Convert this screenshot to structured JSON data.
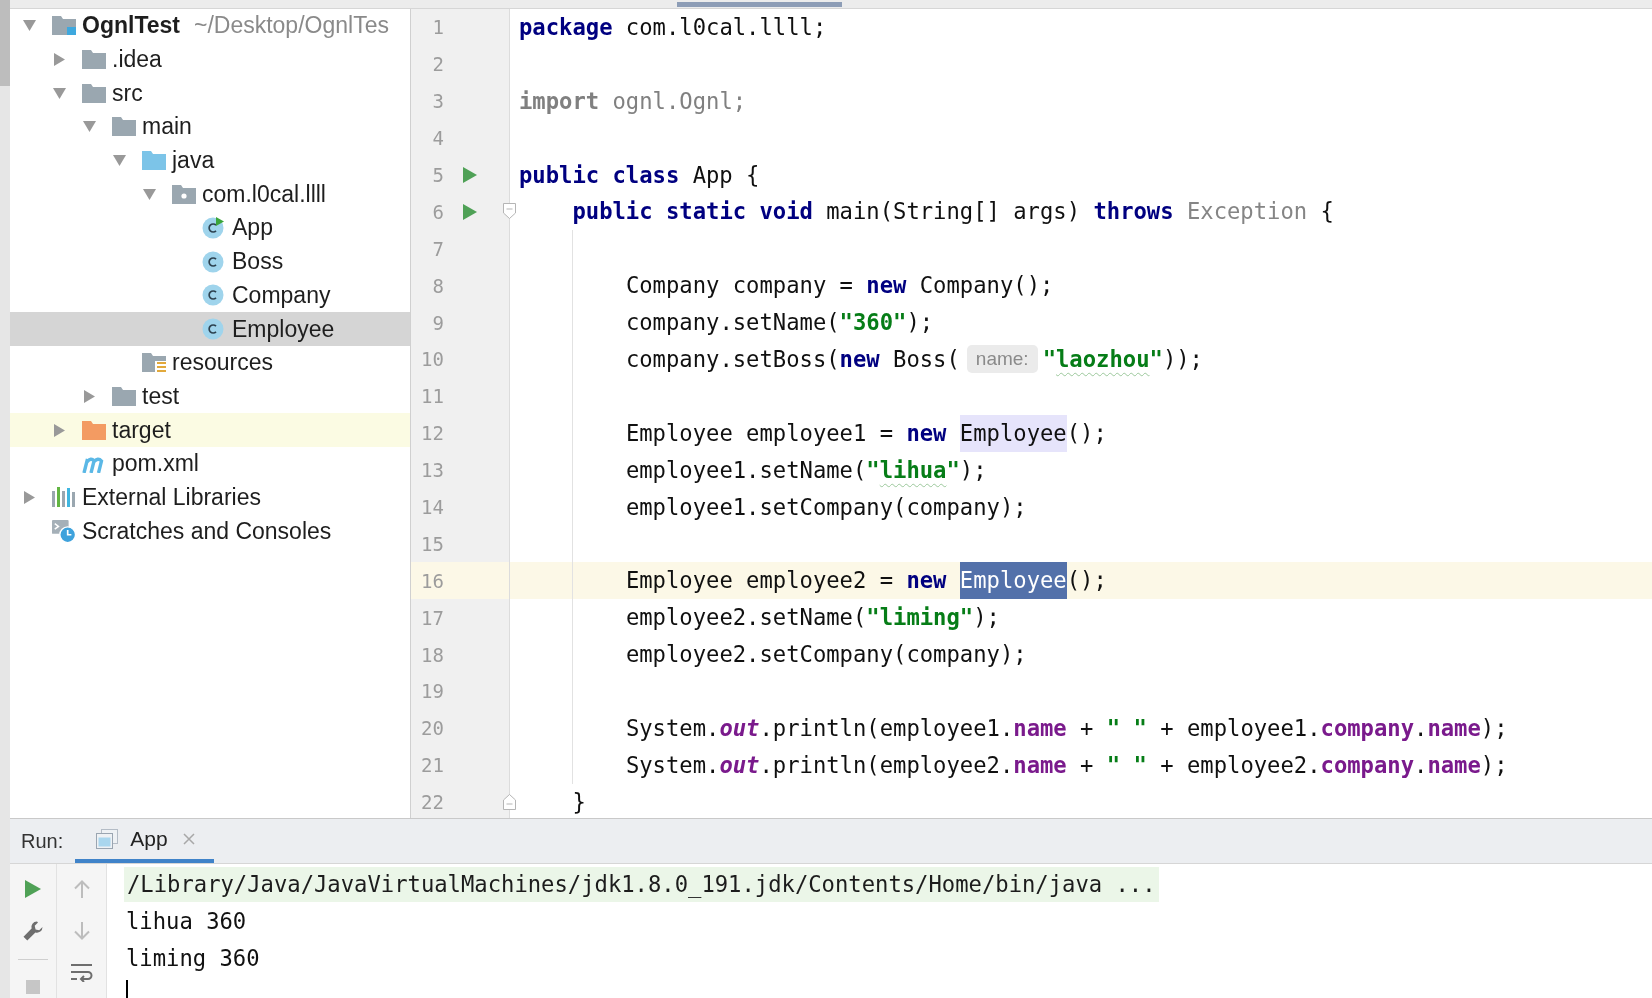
{
  "project_tree": [
    {
      "label": "OgnlTest",
      "detail": "~/Desktop/OgnlTes",
      "kind": "module",
      "expanded": true,
      "selected": false,
      "ignored": false,
      "children": [
        {
          "label": ".idea",
          "kind": "folder",
          "expanded": false,
          "selected": false,
          "ignored": false
        },
        {
          "label": "src",
          "kind": "folder",
          "expanded": true,
          "selected": false,
          "ignored": false,
          "children": [
            {
              "label": "main",
              "kind": "folder",
              "expanded": true,
              "selected": false,
              "ignored": false,
              "children": [
                {
                  "label": "java",
                  "kind": "source-root",
                  "expanded": true,
                  "selected": false,
                  "ignored": false,
                  "children": [
                    {
                      "label": "com.l0cal.llll",
                      "kind": "package",
                      "expanded": true,
                      "selected": false,
                      "ignored": false,
                      "children": [
                        {
                          "label": "App",
                          "kind": "main-class",
                          "selected": false,
                          "ignored": false
                        },
                        {
                          "label": "Boss",
                          "kind": "class",
                          "selected": false,
                          "ignored": false
                        },
                        {
                          "label": "Company",
                          "kind": "class",
                          "selected": false,
                          "ignored": false
                        },
                        {
                          "label": "Employee",
                          "kind": "class",
                          "selected": true,
                          "ignored": false
                        }
                      ]
                    }
                  ]
                },
                {
                  "label": "resources",
                  "kind": "resources-root",
                  "selected": false,
                  "ignored": false
                }
              ]
            },
            {
              "label": "test",
              "kind": "folder",
              "expanded": false,
              "selected": false,
              "ignored": false
            }
          ]
        },
        {
          "label": "target",
          "kind": "excluded-folder",
          "expanded": false,
          "selected": false,
          "ignored": true
        },
        {
          "label": "pom.xml",
          "kind": "maven",
          "selected": false,
          "ignored": false
        }
      ]
    },
    {
      "label": "External Libraries",
      "kind": "libraries",
      "expanded": false,
      "selected": false,
      "ignored": false
    },
    {
      "label": "Scratches and Consoles",
      "kind": "scratches",
      "selected": false,
      "ignored": false
    }
  ],
  "editor": {
    "lines": [
      {
        "number": "1",
        "run_marker": false,
        "fold_marker": false,
        "current": false,
        "tokens": [
          {
            "text": "package",
            "kind": "keyword"
          },
          {
            "text": " com.l0cal.llll;",
            "kind": "plain"
          }
        ]
      },
      {
        "number": "2",
        "run_marker": false,
        "fold_marker": false,
        "current": false
      },
      {
        "number": "3",
        "run_marker": false,
        "fold_marker": false,
        "current": false,
        "tokens": [
          {
            "text": "import",
            "kind": "unused-keyword"
          },
          {
            "text": " ognl.Ognl;",
            "kind": "unused"
          }
        ]
      },
      {
        "number": "4",
        "run_marker": false,
        "fold_marker": false,
        "current": false
      },
      {
        "number": "5",
        "run_marker": true,
        "fold_marker": false,
        "current": false,
        "tokens": [
          {
            "text": "public class",
            "kind": "keyword"
          },
          {
            "text": " App {",
            "kind": "plain"
          }
        ]
      },
      {
        "number": "6",
        "run_marker": true,
        "fold_marker": true,
        "current": false,
        "tokens": [
          {
            "text": "    public static void",
            "kind": "keyword"
          },
          {
            "text": " main(String[] args) ",
            "kind": "plain"
          },
          {
            "text": "throws",
            "kind": "keyword"
          },
          {
            "text": " Exception",
            "kind": "dimmed"
          },
          {
            "text": " {",
            "kind": "plain"
          }
        ]
      },
      {
        "number": "7",
        "run_marker": false,
        "fold_marker": false,
        "current": false
      },
      {
        "number": "8",
        "run_marker": false,
        "fold_marker": false,
        "current": false,
        "tokens": [
          {
            "text": "        Company company = ",
            "kind": "plain"
          },
          {
            "text": "new",
            "kind": "keyword"
          },
          {
            "text": " Company();",
            "kind": "plain"
          }
        ]
      },
      {
        "number": "9",
        "run_marker": false,
        "fold_marker": false,
        "current": false,
        "tokens": [
          {
            "text": "        company.setName(",
            "kind": "plain"
          },
          {
            "text": "\"360\"",
            "kind": "string"
          },
          {
            "text": ");",
            "kind": "plain"
          }
        ]
      },
      {
        "number": "10",
        "run_marker": false,
        "fold_marker": false,
        "current": false,
        "tokens": [
          {
            "text": "        company.setBoss(",
            "kind": "plain"
          },
          {
            "text": "new",
            "kind": "keyword"
          },
          {
            "text": " Boss(",
            "kind": "plain"
          },
          {
            "text": "name:",
            "kind": "hint"
          },
          {
            "text": "\"",
            "kind": "string"
          },
          {
            "text": "laozhou",
            "kind": "string-typo"
          },
          {
            "text": "\"",
            "kind": "string"
          },
          {
            "text": "));",
            "kind": "plain"
          }
        ]
      },
      {
        "number": "11",
        "run_marker": false,
        "fold_marker": false,
        "current": false
      },
      {
        "number": "12",
        "run_marker": false,
        "fold_marker": false,
        "current": false,
        "tokens": [
          {
            "text": "        Employee employee1 = ",
            "kind": "plain"
          },
          {
            "text": "new ",
            "kind": "keyword"
          },
          {
            "text": "Employee",
            "kind": "usage"
          },
          {
            "text": "();",
            "kind": "plain"
          }
        ]
      },
      {
        "number": "13",
        "run_marker": false,
        "fold_marker": false,
        "current": false,
        "tokens": [
          {
            "text": "        employee1.setName(",
            "kind": "plain"
          },
          {
            "text": "\"",
            "kind": "string"
          },
          {
            "text": "lihua",
            "kind": "string-typo"
          },
          {
            "text": "\"",
            "kind": "string"
          },
          {
            "text": ");",
            "kind": "plain"
          }
        ]
      },
      {
        "number": "14",
        "run_marker": false,
        "fold_marker": false,
        "current": false,
        "tokens": [
          {
            "text": "        employee1.setCompany(company);",
            "kind": "plain"
          }
        ]
      },
      {
        "number": "15",
        "run_marker": false,
        "fold_marker": false,
        "current": false
      },
      {
        "number": "16",
        "run_marker": false,
        "fold_marker": false,
        "current": true,
        "tokens": [
          {
            "text": "        Employee employee2 = ",
            "kind": "plain"
          },
          {
            "text": "new ",
            "kind": "keyword"
          },
          {
            "text": "Employee",
            "kind": "selection"
          },
          {
            "text": "();",
            "kind": "plain"
          }
        ]
      },
      {
        "number": "17",
        "run_marker": false,
        "fold_marker": false,
        "current": false,
        "tokens": [
          {
            "text": "        employee2.setName(",
            "kind": "plain"
          },
          {
            "text": "\"liming\"",
            "kind": "string"
          },
          {
            "text": ");",
            "kind": "plain"
          }
        ]
      },
      {
        "number": "18",
        "run_marker": false,
        "fold_marker": false,
        "current": false,
        "tokens": [
          {
            "text": "        employee2.setCompany(company);",
            "kind": "plain"
          }
        ]
      },
      {
        "number": "19",
        "run_marker": false,
        "fold_marker": false,
        "current": false
      },
      {
        "number": "20",
        "run_marker": false,
        "fold_marker": false,
        "current": false,
        "tokens": [
          {
            "text": "        System.",
            "kind": "plain"
          },
          {
            "text": "out",
            "kind": "static-field"
          },
          {
            "text": ".println(employee1.",
            "kind": "plain"
          },
          {
            "text": "name",
            "kind": "field"
          },
          {
            "text": " + ",
            "kind": "plain"
          },
          {
            "text": "\" \"",
            "kind": "string"
          },
          {
            "text": " + employee1.",
            "kind": "plain"
          },
          {
            "text": "company",
            "kind": "field"
          },
          {
            "text": ".",
            "kind": "plain"
          },
          {
            "text": "name",
            "kind": "field"
          },
          {
            "text": ");",
            "kind": "plain"
          }
        ]
      },
      {
        "number": "21",
        "run_marker": false,
        "fold_marker": false,
        "current": false,
        "tokens": [
          {
            "text": "        System.",
            "kind": "plain"
          },
          {
            "text": "out",
            "kind": "static-field"
          },
          {
            "text": ".println(employee2.",
            "kind": "plain"
          },
          {
            "text": "name",
            "kind": "field"
          },
          {
            "text": " + ",
            "kind": "plain"
          },
          {
            "text": "\" \"",
            "kind": "string"
          },
          {
            "text": " + employee2.",
            "kind": "plain"
          },
          {
            "text": "company",
            "kind": "field"
          },
          {
            "text": ".",
            "kind": "plain"
          },
          {
            "text": "name",
            "kind": "field"
          },
          {
            "text": ");",
            "kind": "plain"
          }
        ]
      },
      {
        "number": "22",
        "run_marker": false,
        "fold_marker": true,
        "current": false,
        "tokens": [
          {
            "text": "    }",
            "kind": "plain"
          }
        ]
      }
    ]
  },
  "run_panel": {
    "title": "Run:",
    "tabs": [
      {
        "label": "App",
        "selected": true
      }
    ],
    "run_toolbar": [
      {
        "kind": "rerun",
        "disabled": false
      },
      {
        "kind": "settings",
        "disabled": false
      },
      {
        "kind": "stop",
        "disabled": true
      }
    ],
    "console_toolbar": [
      {
        "kind": "scroll-up",
        "disabled": true
      },
      {
        "kind": "scroll-down",
        "disabled": true
      },
      {
        "kind": "soft-wrap",
        "disabled": false
      }
    ],
    "console": [
      {
        "kind": "command",
        "text": "/Library/Java/JavaVirtualMachines/jdk1.8.0_191.jdk/Contents/Home/bin/java ..."
      },
      {
        "kind": "output",
        "text": "lihua 360"
      },
      {
        "kind": "output",
        "text": "liming 360"
      }
    ]
  }
}
